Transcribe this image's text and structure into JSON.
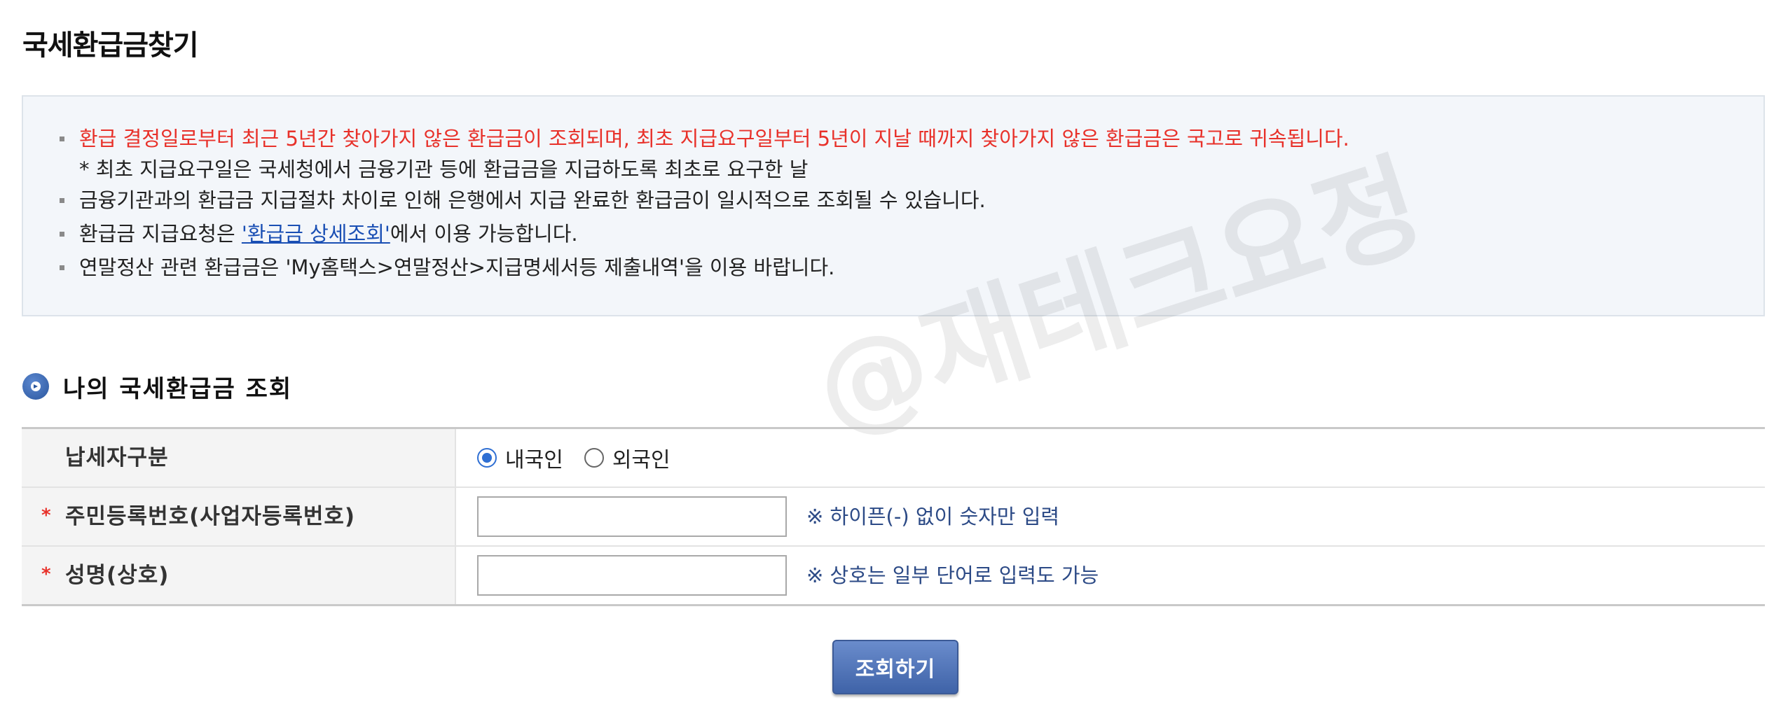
{
  "page": {
    "title": "국세환급금찾기"
  },
  "notice": {
    "line1": "환급 결정일로부터 최근 5년간 찾아가지 않은 환급금이 조회되며, 최초 지급요구일부터 5년이 지날 때까지 찾아가지 않은 환급금은 국고로 귀속됩니다.",
    "line1_note": "* 최초 지급요구일은 국세청에서 금융기관 등에 환급금을 지급하도록 최초로 요구한 날",
    "line2": "금융기관과의 환급금 지급절차 차이로 인해 은행에서 지급 완료한 환급금이 일시적으로 조회될 수 있습니다.",
    "line3_prefix": "환급금 지급요청은 ",
    "line3_link": "'환급금 상세조회'",
    "line3_suffix": "에서 이용 가능합니다.",
    "line4": "연말정산 관련 환급금은 'My홈택스>연말정산>지급명세서등 제출내역'을 이용 바랍니다."
  },
  "section": {
    "title": "나의 국세환급금 조회"
  },
  "form": {
    "taxpayer_type": {
      "label": "납세자구분",
      "options": [
        "내국인",
        "외국인"
      ],
      "selected": "내국인"
    },
    "id_number": {
      "required_mark": "*",
      "label": "주민등록번호(사업자등록번호)",
      "value": "",
      "hint": "※ 하이픈(-) 없이 숫자만 입력"
    },
    "name": {
      "required_mark": "*",
      "label": "성명(상호)",
      "value": "",
      "hint": "※ 상호는 일부 단어로 입력도 가능"
    }
  },
  "buttons": {
    "submit_label": "조회하기"
  },
  "watermark": "@재테크요정",
  "colors": {
    "notice_red": "#e8312a",
    "link_blue": "#1a4fb4",
    "hint_blue": "#2c4a86",
    "button_blue": "#4a6db0"
  }
}
